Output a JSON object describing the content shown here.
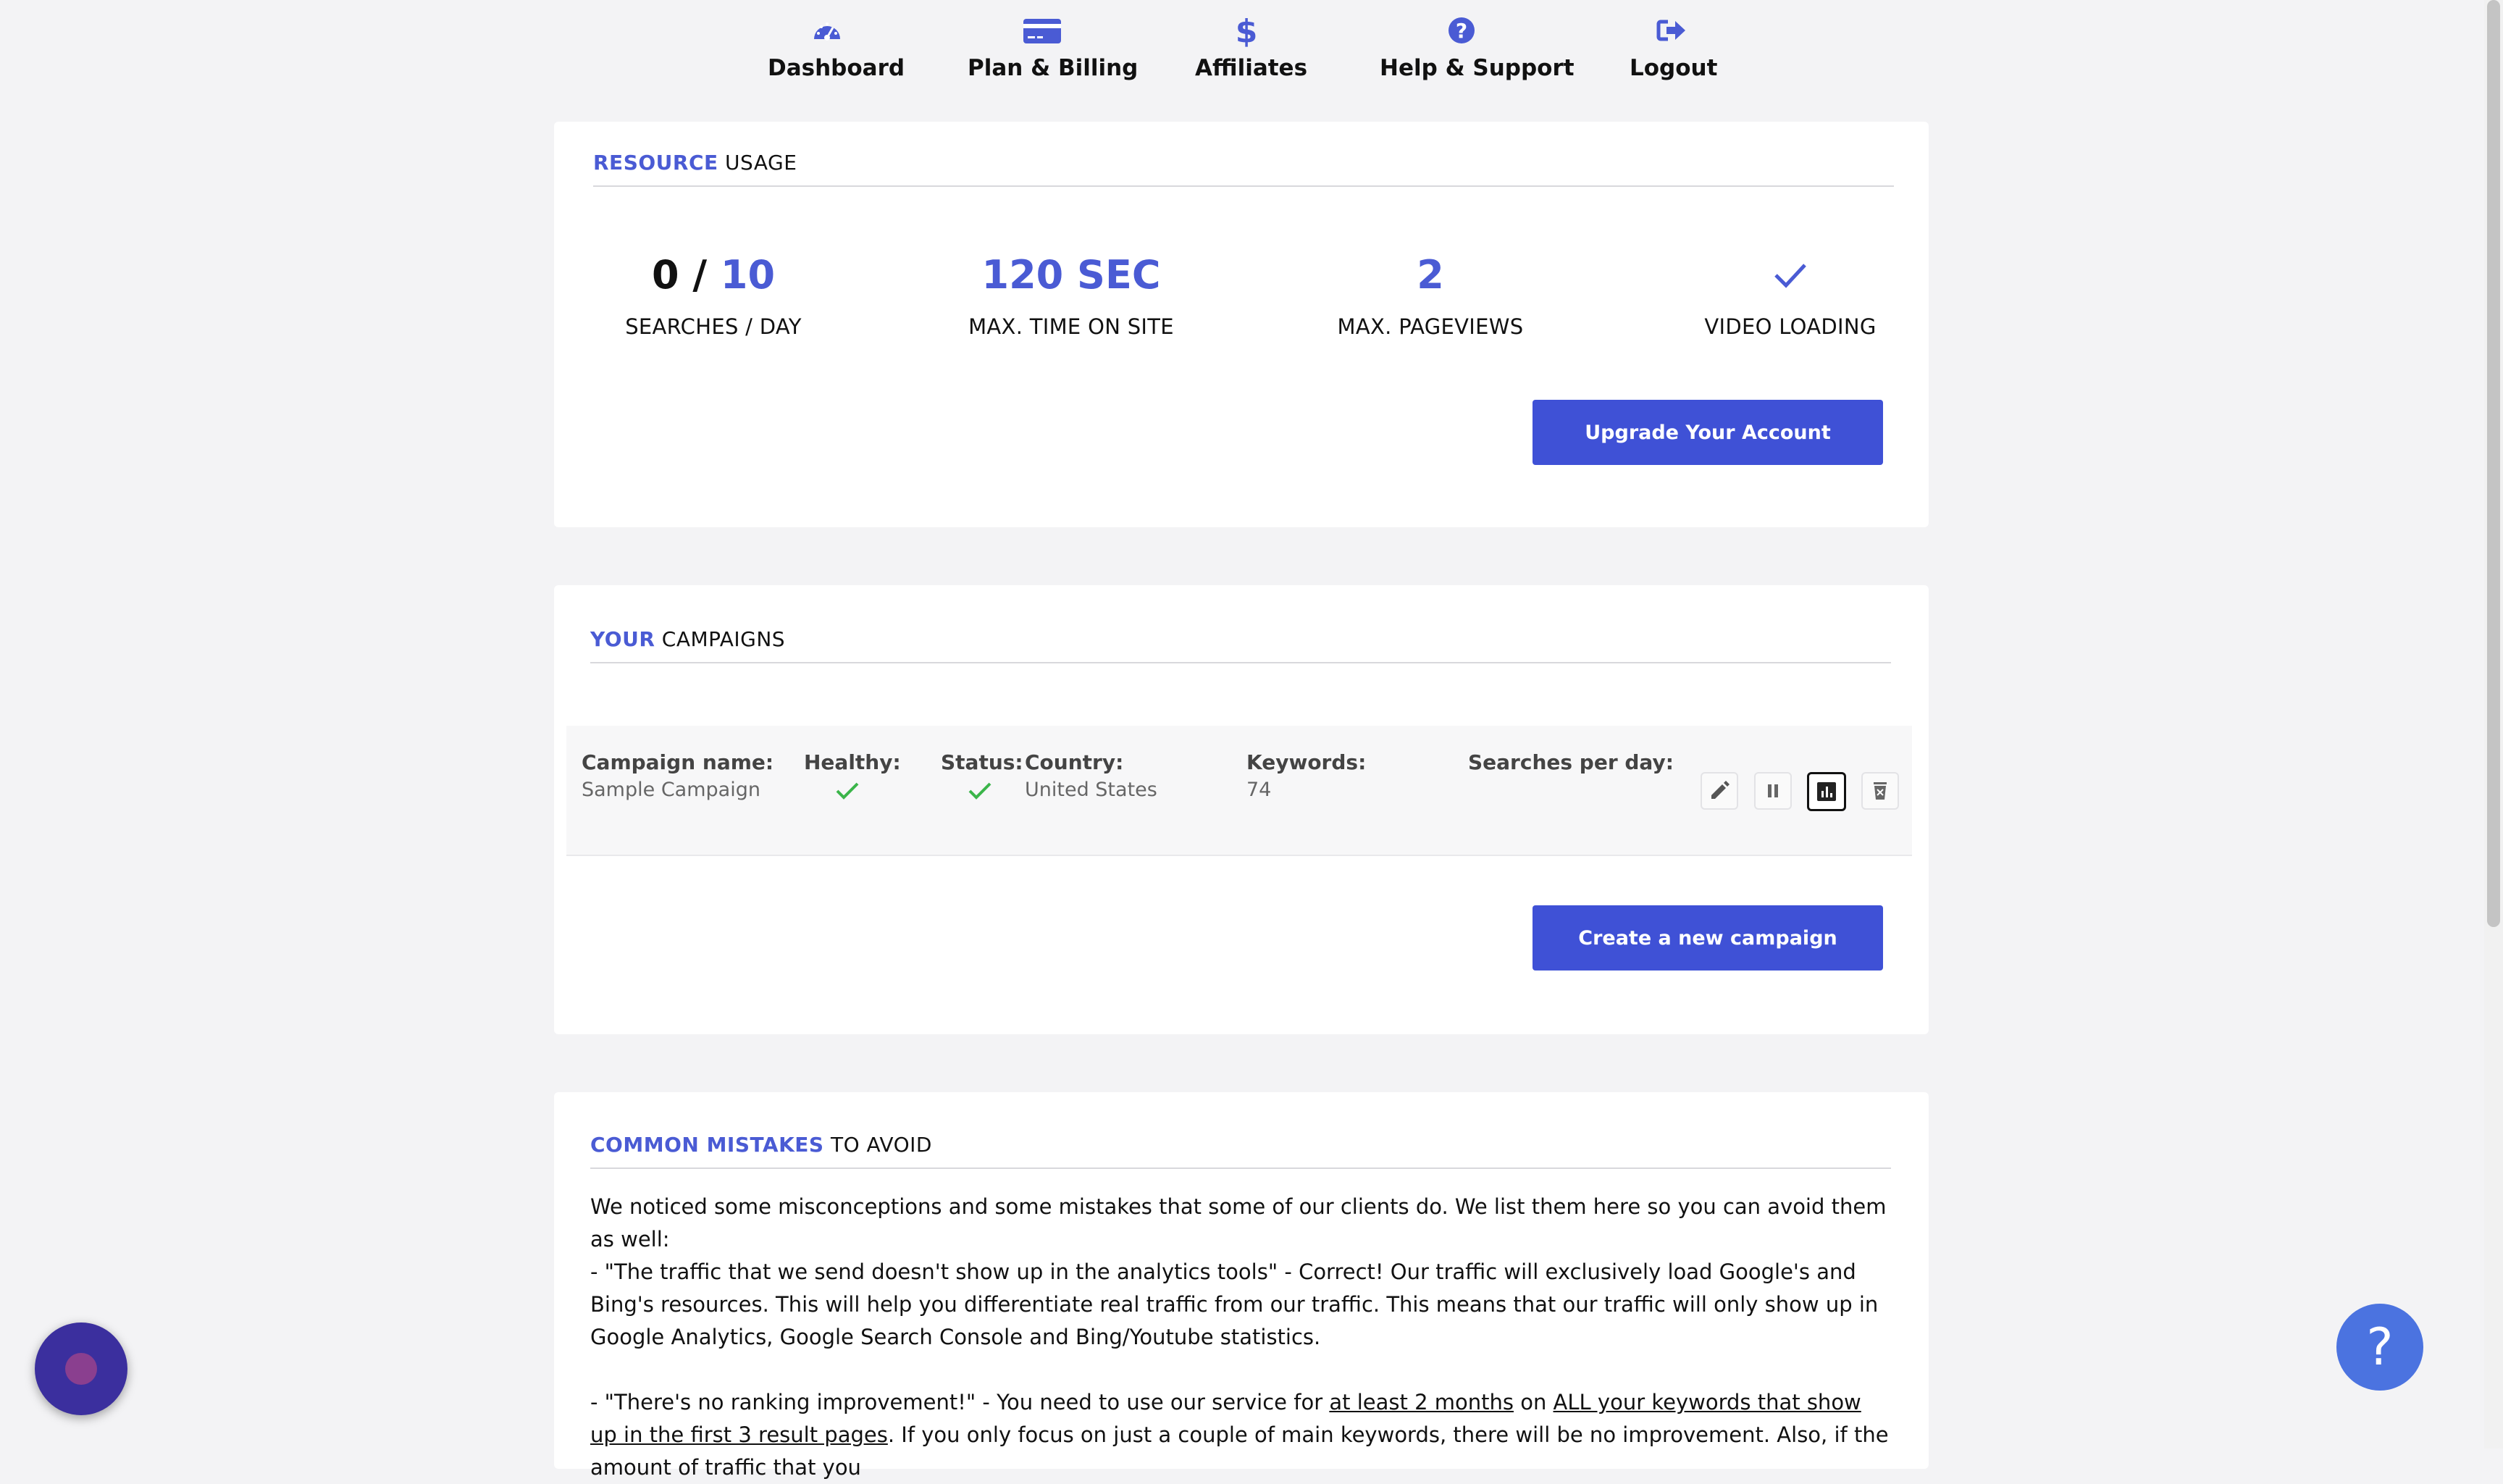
{
  "nav": {
    "items": [
      {
        "label": "Dashboard",
        "icon": "dashboard-gauge-icon"
      },
      {
        "label": "Plan & Billing",
        "icon": "credit-card-icon"
      },
      {
        "label": "Affiliates",
        "icon": "dollar-icon"
      },
      {
        "label": "Help & Support",
        "icon": "question-circle-icon"
      },
      {
        "label": "Logout",
        "icon": "logout-icon"
      }
    ]
  },
  "resource_usage": {
    "title_accent": "RESOURCE",
    "title_rest": "USAGE",
    "searches": {
      "used": "0",
      "sep": " / ",
      "limit": "10",
      "caption": "SEARCHES / DAY"
    },
    "time": {
      "value": "120 SEC",
      "caption": "MAX. TIME ON SITE"
    },
    "pageviews": {
      "value": "2",
      "caption": "MAX. PAGEVIEWS"
    },
    "video": {
      "caption": "VIDEO LOADING",
      "icon": "checkmark-icon"
    },
    "upgrade_button": "Upgrade Your Account"
  },
  "campaigns": {
    "title_accent": "YOUR",
    "title_rest": "CAMPAIGNS",
    "row": {
      "name_label": "Campaign name:",
      "name_value": "Sample Campaign",
      "healthy_label": "Healthy:",
      "status_label": "Status:",
      "country_label": "Country:",
      "country_value": "United States",
      "keywords_label": "Keywords:",
      "keywords_value": "74",
      "searches_label": "Searches per day:",
      "actions": [
        "edit-icon",
        "pause-icon",
        "bar-chart-icon",
        "trash-icon"
      ]
    },
    "create_button": "Create a new campaign"
  },
  "mistakes": {
    "title_accent": "COMMON MISTAKES",
    "title_rest": "TO AVOID",
    "intro": "We noticed some misconceptions and some mistakes that some of our clients do. We list them here so you can avoid them as well:",
    "item1": "- \"The traffic that we send doesn't show up in the analytics tools\" - Correct! Our traffic will exclusively load Google's and Bing's resources. This will help you differentiate real traffic from our traffic. This means that our traffic will only show up in Google Analytics, Google Search Console and Bing/Youtube statistics.",
    "item2_a": "- \"There's no ranking improvement!\" - You need to use our service for ",
    "item2_u1": "at least 2 months",
    "item2_b": " on ",
    "item2_u2": "ALL your keywords that show up in the first 3 result pages",
    "item2_c": ". If you only focus on just a couple of main keywords, there will be no improvement. Also, if the amount of traffic that you"
  },
  "colors": {
    "accent": "#4a5bd4",
    "button": "#3f51d6",
    "check": "#3bb54a",
    "help_fab": "#4b73e0"
  },
  "help_fab_label": "?"
}
